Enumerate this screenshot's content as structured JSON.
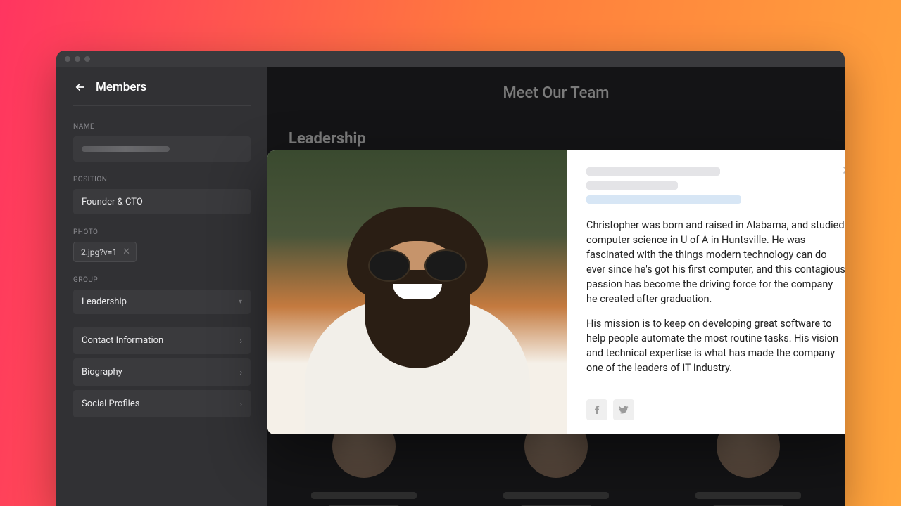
{
  "sidebar": {
    "title": "Members",
    "labels": {
      "name": "NAME",
      "position": "POSITION",
      "photo": "PHOTO",
      "group": "GROUP"
    },
    "position_value": "Founder & CTO",
    "photo_chip": "2.jpg?v=1",
    "group_value": "Leadership",
    "rows": [
      {
        "label": "Contact Information"
      },
      {
        "label": "Biography"
      },
      {
        "label": "Social Profiles"
      }
    ]
  },
  "preview": {
    "page_title": "Meet Our Team",
    "section_title": "Leadership"
  },
  "modal": {
    "bio_p1": "Christopher was born and raised in Alabama, and studied computer science in U of A in Huntsville. He was fascinated with the things modern technology can do ever since he's got his first computer, and this contagious passion has become the driving force for the company he created after graduation.",
    "bio_p2": "His mission is to keep on developing great software to help people automate the most routine tasks. His vision and technical expertise is what has made the company one of the leaders of IT industry."
  }
}
